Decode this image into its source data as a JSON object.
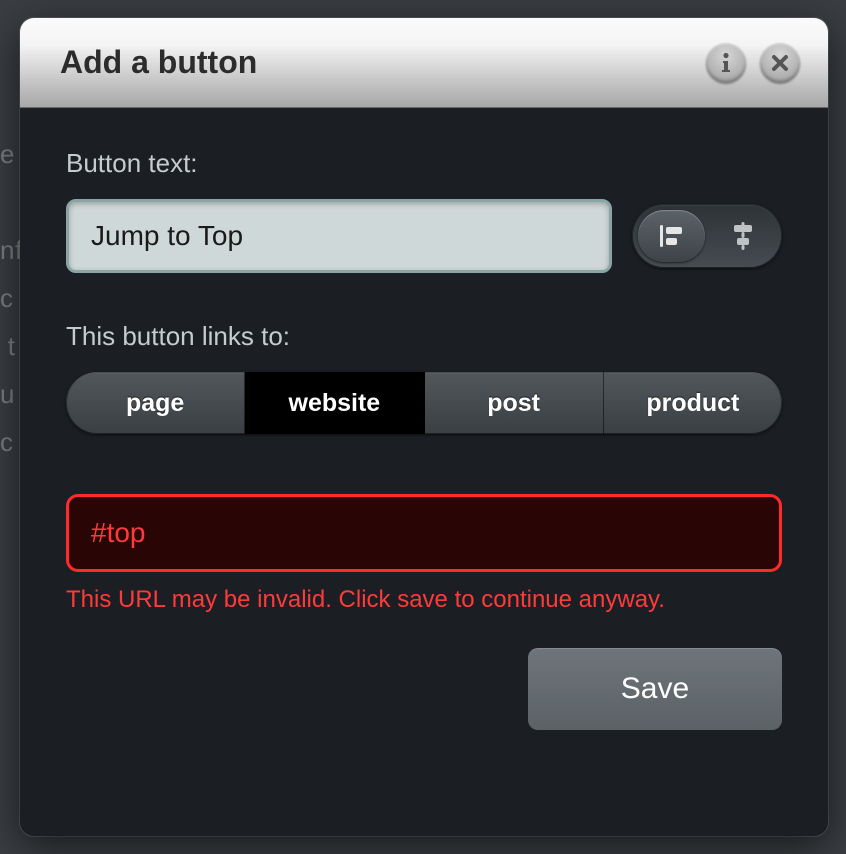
{
  "dialog": {
    "title": "Add a button"
  },
  "form": {
    "button_text_label": "Button text:",
    "button_text_value": "Jump to Top",
    "links_to_label": "This button links to:",
    "url_value": "#top",
    "error_message": "This URL may be invalid. Click save to continue anyway.",
    "save_label": "Save"
  },
  "link_targets": {
    "options": [
      "page",
      "website",
      "post",
      "product"
    ],
    "selected": "website"
  },
  "alignment": {
    "options": [
      "left",
      "center"
    ],
    "selected": "left"
  },
  "icons": {
    "info": "info-icon",
    "close": "close-icon",
    "align_left": "align-left-icon",
    "align_center": "align-center-icon"
  },
  "colors": {
    "error": "#ff3a3a",
    "modal_bg": "#1b1f23"
  }
}
